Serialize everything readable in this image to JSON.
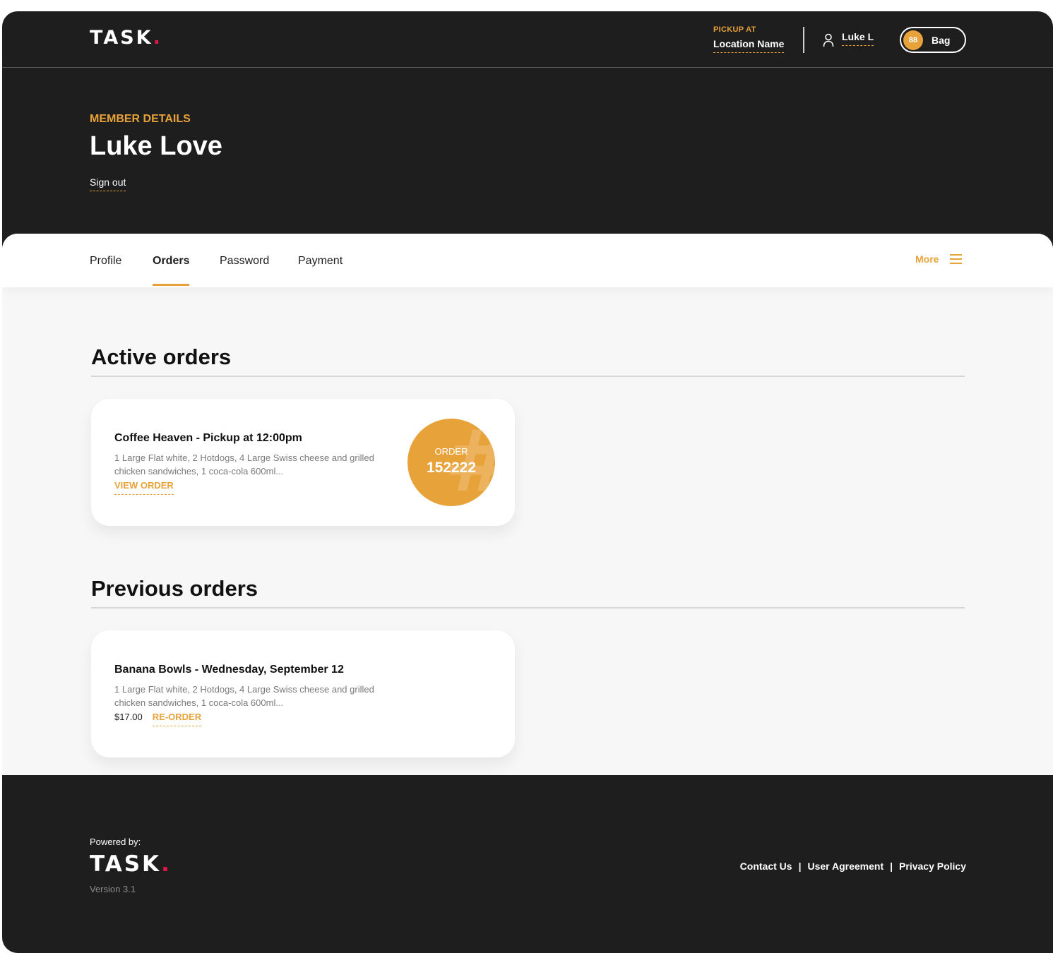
{
  "header": {
    "logo": "TASK",
    "logo_dot": ".",
    "pickup_label": "PICKUP AT",
    "pickup_location": "Location Name",
    "user_name": "Luke L",
    "bag_count": "88",
    "bag_label": "Bag"
  },
  "member": {
    "section_label": "MEMBER DETAILS",
    "full_name": "Luke Love",
    "sign_out": "Sign out"
  },
  "tabs": {
    "items": [
      {
        "label": "Profile"
      },
      {
        "label": "Orders"
      },
      {
        "label": "Password"
      },
      {
        "label": "Payment"
      }
    ],
    "active": "Orders",
    "more_label": "More"
  },
  "active_orders": {
    "title": "Active orders",
    "orders": [
      {
        "title": "Coffee Heaven - Pickup at 12:00pm",
        "description": "1 Large Flat white, 2 Hotdogs, 4 Large Swiss cheese and grilled chicken sandwiches, 1 coca-cola 600ml...",
        "link": "VIEW ORDER",
        "badge_label": "ORDER",
        "order_number": "152222"
      }
    ]
  },
  "previous_orders": {
    "title": "Previous orders",
    "orders": [
      {
        "title": "Banana Bowls - Wednesday, September 12",
        "description": "1 Large Flat white, 2 Hotdogs, 4 Large Swiss cheese and grilled chicken sandwiches, 1 coca-cola 600ml...",
        "price": "$17.00",
        "link": "RE-ORDER"
      }
    ]
  },
  "footer": {
    "powered_by": "Powered by:",
    "logo": "TASK",
    "logo_dot": ".",
    "version": "Version 3.1",
    "links": [
      "Contact Us",
      "User Agreement",
      "Privacy Policy"
    ],
    "separator": "|"
  },
  "colors": {
    "background": "#1e1e1e",
    "accent": "#e8a23a",
    "logo_dot": "#e0184a",
    "content_bg": "#f7f7f7"
  },
  "icons": {
    "user": "user-icon",
    "menu": "hamburger-menu-icon"
  }
}
